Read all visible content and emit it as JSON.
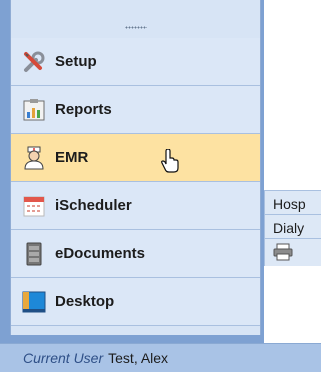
{
  "menu": {
    "items": [
      {
        "label": "Setup",
        "icon": "tools-icon"
      },
      {
        "label": "Reports",
        "icon": "reports-icon"
      },
      {
        "label": "EMR",
        "icon": "doctor-icon"
      },
      {
        "label": "iScheduler",
        "icon": "calendar-icon"
      },
      {
        "label": "eDocuments",
        "icon": "cabinet-icon"
      },
      {
        "label": "Desktop",
        "icon": "desktop-icon"
      }
    ],
    "active_index": 2
  },
  "submenu": {
    "items": [
      "Hosp",
      "Dialy"
    ]
  },
  "status": {
    "label": "Current User",
    "value": "Test, Alex"
  },
  "colors": {
    "active": "#fde2a2",
    "item_bg": "#dbe7f7",
    "frame": "#7ea1d2"
  }
}
